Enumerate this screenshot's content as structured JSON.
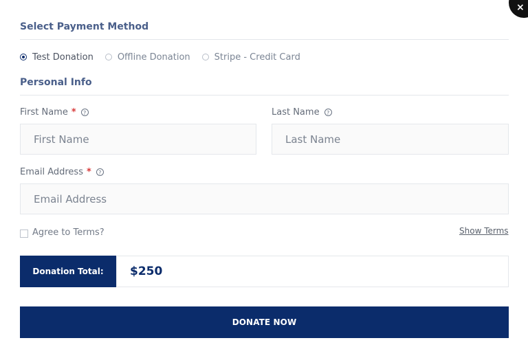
{
  "modal": {
    "close_label": "×"
  },
  "payment": {
    "title": "Select Payment Method",
    "options": [
      {
        "label": "Test Donation",
        "selected": true
      },
      {
        "label": "Offline Donation",
        "selected": false
      },
      {
        "label": "Stripe - Credit Card",
        "selected": false
      }
    ]
  },
  "personal": {
    "title": "Personal Info",
    "first_name": {
      "label": "First Name",
      "required_mark": "*",
      "help_icon": "?",
      "placeholder": "First Name"
    },
    "last_name": {
      "label": "Last Name",
      "help_icon": "?",
      "placeholder": "Last Name"
    },
    "email": {
      "label": "Email Address",
      "required_mark": "*",
      "help_icon": "?",
      "placeholder": "Email Address"
    }
  },
  "terms": {
    "agree_label": "Agree to Terms?",
    "show_terms_label": "Show Terms"
  },
  "total": {
    "label": "Donation Total:",
    "amount": "$250"
  },
  "actions": {
    "donate_label": "DONATE NOW"
  },
  "colors": {
    "primary": "#0b2c6b",
    "required": "#d83b3b",
    "section_title": "#4a5f8a"
  }
}
